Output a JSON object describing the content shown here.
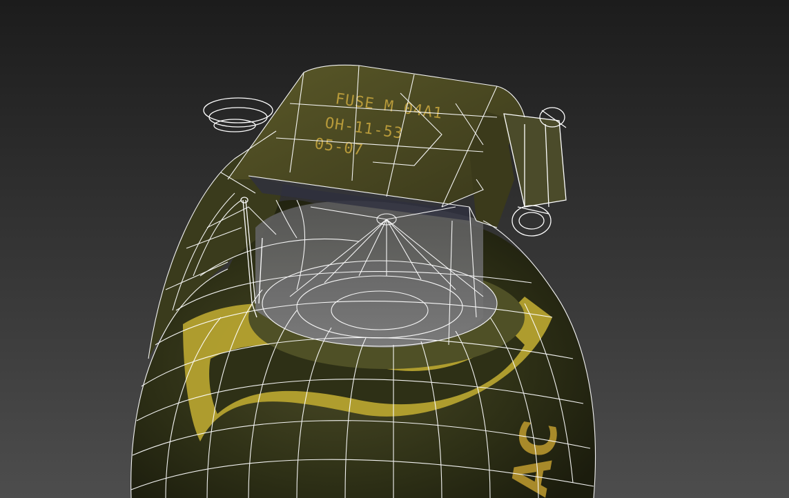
{
  "scene": {
    "subject": "grenade-3d-model-wireframe-overlay",
    "colors": {
      "background_top": "#1c1c1c",
      "background_bottom": "#4a4a4a",
      "body_dark": "#2e3016",
      "body_band": "#b5a22f",
      "fuse_metal": "#4b4a22",
      "wire": "#ffffff"
    }
  },
  "fuse_stamp": {
    "line1": "FUSE M 04A1",
    "line2": "OH-11-53",
    "line3": "05-07"
  },
  "body_marking": {
    "partial_text": "AC"
  }
}
